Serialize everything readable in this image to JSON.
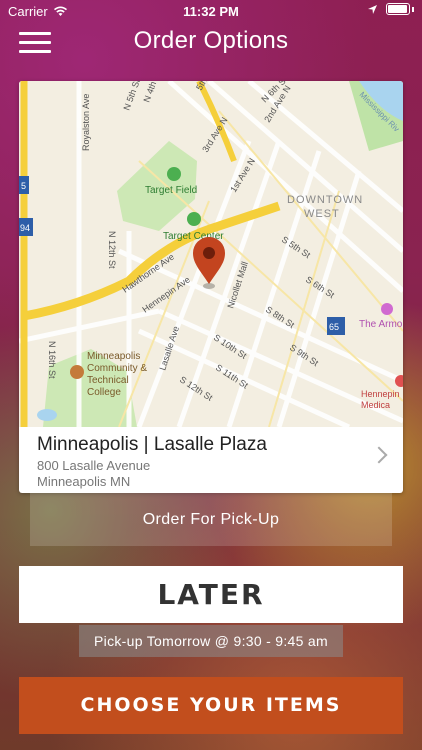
{
  "status_bar": {
    "carrier": "Carrier",
    "time": "11:32 PM"
  },
  "nav": {
    "title": "Order Options"
  },
  "map": {
    "streets": [
      "N 5th St",
      "N 4th St",
      "5th",
      "3rd Ave N",
      "2nd Ave N",
      "1st Ave N",
      "N 6th St",
      "Royalston Ave",
      "N 12th St",
      "Hawthorne Ave",
      "Hennepin Ave",
      "Nicollet Mall",
      "S 5th St",
      "S 6th St",
      "S 8th St",
      "S 9th St",
      "S 10th St",
      "S 11th St",
      "S 12th St",
      "Lasalle Ave",
      "N 16th St"
    ],
    "places": {
      "target_field": "Target Field",
      "target_center": "Target Center",
      "downtown_line1": "DOWNTOWN",
      "downtown_line2": "WEST",
      "college_line1": "Minneapolis",
      "college_line2": "Community &",
      "college_line3": "Technical",
      "college_line4": "College",
      "armory": "The Armo",
      "hennepin_line1": "Hennepin",
      "hennepin_line2": "Medica",
      "interstate": "94",
      "route65": "65",
      "route_5": "5",
      "mississippi": "Mississippi Riv"
    }
  },
  "location": {
    "name": "Minneapolis | Lasalle Plaza",
    "address": "800 Lasalle Avenue",
    "city": "Minneapolis MN"
  },
  "order_type": "Order For Pick-Up",
  "timing": {
    "label": "LATER",
    "detail": "Pick-up Tomorrow @ 9:30 - 9:45 am"
  },
  "cta": {
    "label": "CHOOSE YOUR ITEMS"
  },
  "colors": {
    "cta": "#c24e1d",
    "pin": "#c3441f",
    "highway": "#f5cf3b",
    "park": "#bfe3a7"
  }
}
